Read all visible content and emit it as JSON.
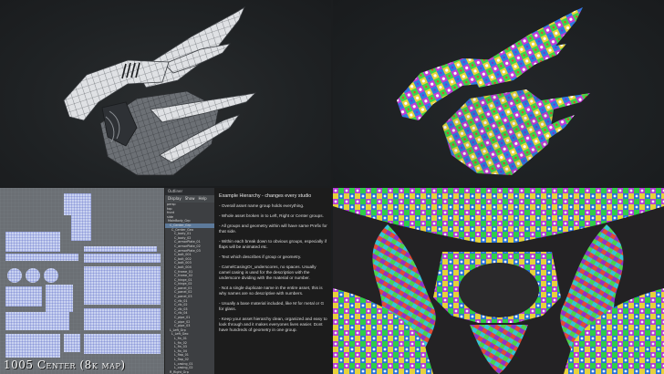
{
  "panels": {
    "top_left": {
      "label": "Wireframe render"
    },
    "top_right": {
      "label": "UV checker render"
    },
    "bottom_right": {
      "label": "Interior checker render"
    }
  },
  "uv_map": {
    "caption": "1005 Center (8k map)"
  },
  "outliner": {
    "title": "Outliner",
    "menu": [
      "Display",
      "Show",
      "Help"
    ],
    "rows": [
      "persp",
      "top",
      "front",
      "side",
      "MainBody_Grp",
      "C_Center_Grp",
      "C_Center_Geo",
      "C_body_01",
      "C_body_02",
      "C_armorPlate_01",
      "C_armorPlate_02",
      "C_armorPlate_03",
      "C_bolt_001",
      "C_bolt_002",
      "C_bolt_003",
      "C_bolt_004",
      "C_frame_01",
      "C_frame_02",
      "C_hinge_01",
      "C_hinge_02",
      "C_panel_01",
      "C_panel_02",
      "C_panel_03",
      "C_rib_01",
      "C_rib_02",
      "C_rib_03",
      "C_rib_04",
      "C_pipe_01",
      "C_pipe_02",
      "C_pipe_03",
      "L_Left_Grp",
      "L_Left_Geo",
      "L_fin_01",
      "L_fin_02",
      "L_fin_03",
      "L_fin_04",
      "L_flap_01",
      "L_flap_02",
      "L_casing_01",
      "L_casing_02",
      "R_Right_Grp",
      "R_Right_Geo",
      "R_fin_01"
    ]
  },
  "notes": {
    "heading": "Example Hierarchy - changes every studio",
    "items": [
      "- Overall asset name group holds everything.",
      "- Whole asset broken in to Left, Right or Center groups.",
      "- All groups and geometry within will have same Prefix for that side.",
      "- Within each break down to obvious groups, especially if flaps will be animated etc.",
      "- Text which describes if group or geometry.",
      "- CamelCasingOr_underscores, no spaces. Usually camel casing is used for the description with the underscore dividing with the material or number.",
      "- Not a single duplicate name in the entire asset, this is why names are so descriptive with numbers.",
      "- Usually a base material included, like M for metal or G for glass.",
      "- Keep your asset hierarchy clean, organized and easy to look through and it makes everyones lives easier. Dont have hundreds of geometry in one group."
    ]
  }
}
